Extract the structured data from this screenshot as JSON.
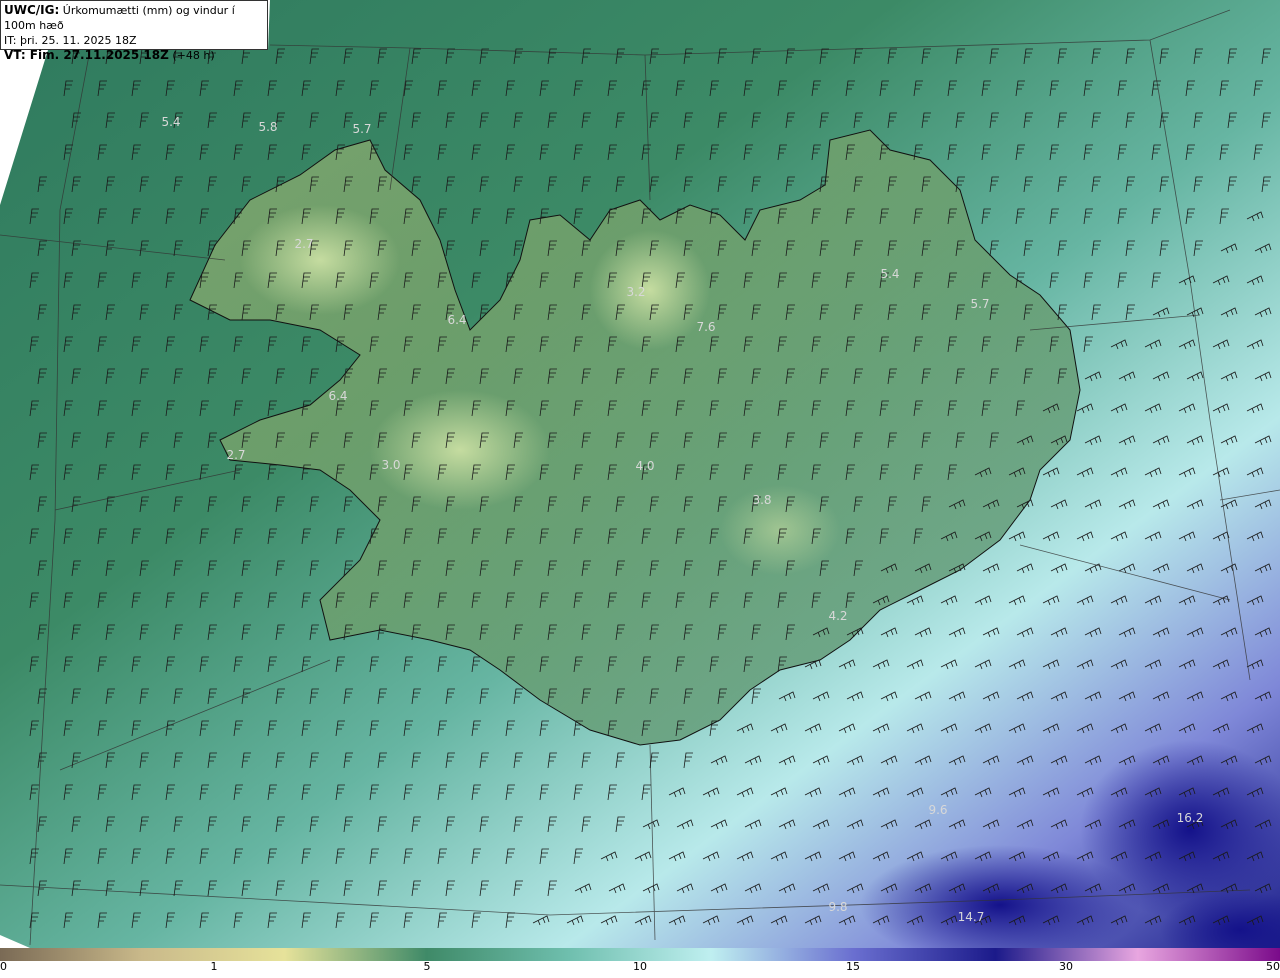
{
  "header": {
    "product": "UWC/IG:",
    "title": "Úrkomumætti (mm) og vindur í 100m hæð",
    "init_time": "IT: þri. 25. 11. 2025 18Z",
    "valid_prefix": "VT: Fim. 27.11.2025 18Z",
    "valid_suffix": "(+48 h)"
  },
  "map": {
    "area": "Iceland",
    "field": "precipitable water (mm)",
    "overlay": "wind barbs at 100 m",
    "values": [
      {
        "text": "5.4"
      },
      {
        "text": "5.8"
      },
      {
        "text": "5.7"
      },
      {
        "text": "2.7"
      },
      {
        "text": "6.4"
      },
      {
        "text": "6.4"
      },
      {
        "text": "2.7"
      },
      {
        "text": "3.0"
      },
      {
        "text": "3.2"
      },
      {
        "text": "7.6"
      },
      {
        "text": "4.0"
      },
      {
        "text": "3.8"
      },
      {
        "text": "5.4"
      },
      {
        "text": "5.7"
      },
      {
        "text": "4.2"
      },
      {
        "text": "9.6"
      },
      {
        "text": "9.8"
      },
      {
        "text": "16.2"
      },
      {
        "text": "14.7"
      }
    ]
  },
  "colorbar": {
    "ticks": [
      "0",
      "1",
      "5",
      "10",
      "15",
      "30",
      "50"
    ],
    "colors": [
      "#7a6a55",
      "#c9b98a",
      "#e6e29a",
      "#3f8a68",
      "#6fbfae",
      "#bfeff0",
      "#6a6fd0",
      "#1b1a8a",
      "#e8a6e0",
      "#7a0a8a"
    ]
  }
}
